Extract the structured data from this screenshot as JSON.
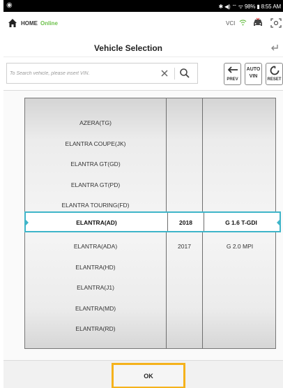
{
  "status_bar": {
    "right_text": "✱ ◀) ⌔ ᯤ 98% ▮ 8:55 AM"
  },
  "nav": {
    "home_label": "HOME",
    "online_label": "Online",
    "vci_label": "VCI"
  },
  "page_title": "Vehicle Selection",
  "search": {
    "placeholder": "To Search vehicle, please insert VIN."
  },
  "tools": {
    "prev_label": "PREV",
    "auto_vin_line1": "AUTO",
    "auto_vin_line2": "VIN",
    "reset_label": "RESET"
  },
  "vehicle_list": {
    "rows": [
      {
        "model": "AZERA(TG)",
        "year": "",
        "engine": ""
      },
      {
        "model": "ELANTRA COUPE(JK)",
        "year": "",
        "engine": ""
      },
      {
        "model": "ELANTRA GT(GD)",
        "year": "",
        "engine": ""
      },
      {
        "model": "ELANTRA GT(PD)",
        "year": "",
        "engine": ""
      },
      {
        "model": "ELANTRA TOURING(FD)",
        "year": "",
        "engine": ""
      },
      {
        "model": "ELANTRA(AD)",
        "year": "2018",
        "engine": "G 1.6 T-GDI"
      },
      {
        "model": "ELANTRA(ADA)",
        "year": "2017",
        "engine": "G 2.0 MPI"
      },
      {
        "model": "ELANTRA(HD)",
        "year": "",
        "engine": ""
      },
      {
        "model": "ELANTRA(J1)",
        "year": "",
        "engine": ""
      },
      {
        "model": "ELANTRA(MD)",
        "year": "",
        "engine": ""
      },
      {
        "model": "ELANTRA(RD)",
        "year": "",
        "engine": ""
      }
    ],
    "selected_index": 5
  },
  "ok_label": "OK",
  "colors": {
    "accent": "#3fb5c9",
    "ok_highlight": "#f5b21b",
    "online": "#6cc04a"
  }
}
